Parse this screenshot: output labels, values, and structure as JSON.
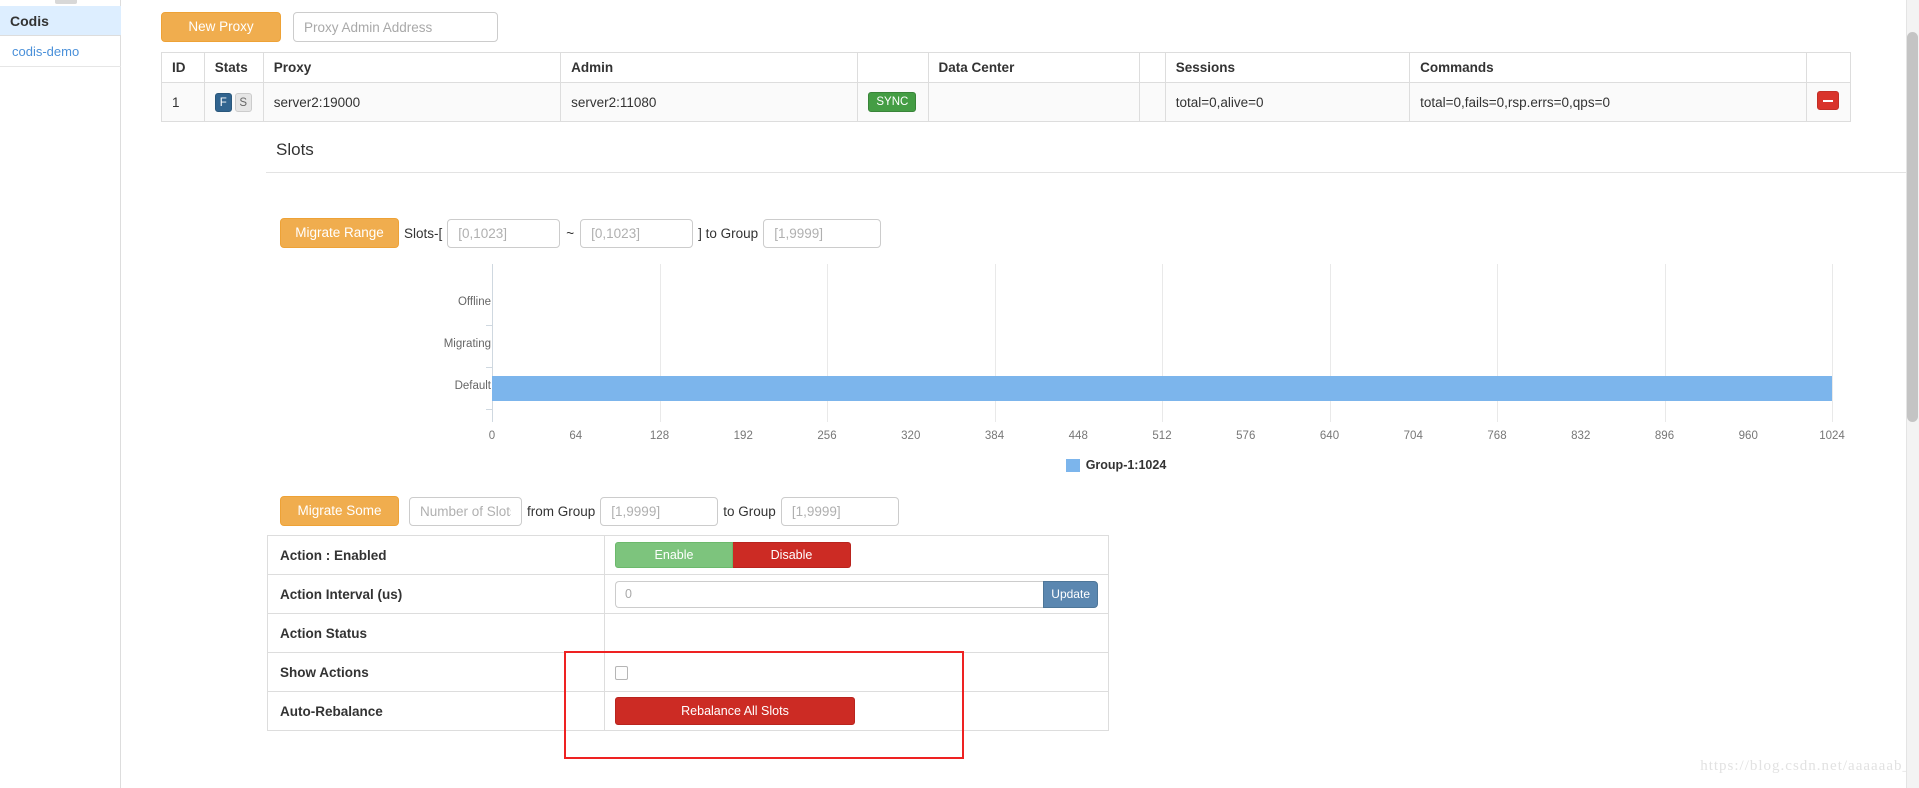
{
  "sidebar": {
    "title": "Codis",
    "items": [
      {
        "label": "codis-demo"
      }
    ]
  },
  "toolbar": {
    "new_proxy_label": "New Proxy",
    "proxy_address_value": "",
    "proxy_address_placeholder": "Proxy Admin Address"
  },
  "proxy_table": {
    "headers": {
      "id": "ID",
      "stats": "Stats",
      "proxy": "Proxy",
      "admin": "Admin",
      "sync": "",
      "data_center": "Data Center",
      "blank": "",
      "sessions": "Sessions",
      "commands": "Commands",
      "actions": ""
    },
    "rows": [
      {
        "id": "1",
        "stats_primary": "F",
        "stats_secondary": "S",
        "proxy": "server2:19000",
        "admin": "server2:11080",
        "sync": "SYNC",
        "data_center": "",
        "sessions": "total=0,alive=0",
        "commands": "total=0,fails=0,rsp.errs=0,qps=0",
        "delete_label": "−"
      }
    ]
  },
  "slots": {
    "title": "Slots",
    "migrate_range": {
      "button_label": "Migrate Range",
      "prefix_label": "Slots-[",
      "from_value": "",
      "from_placeholder": "[0,1023]",
      "separator": "~",
      "to_value": "",
      "to_placeholder": "[0,1023]",
      "suffix_label": "] to Group",
      "group_value": "",
      "group_placeholder": "[1,9999]"
    },
    "migrate_some": {
      "button_label": "Migrate Some",
      "count_value": "",
      "count_placeholder": "Number of Slots",
      "from_label": "from Group",
      "from_value": "",
      "from_placeholder": "[1,9999]",
      "to_label": "to Group",
      "to_value": "",
      "to_placeholder": "[1,9999]"
    }
  },
  "chart_data": {
    "type": "bar",
    "orientation": "horizontal",
    "title": "",
    "xlabel": "",
    "ylabel": "",
    "categories": [
      "Offline",
      "Migrating",
      "Default"
    ],
    "values": [
      0,
      0,
      1024
    ],
    "xlim": [
      0,
      1024
    ],
    "xticks": [
      0,
      64,
      128,
      192,
      256,
      320,
      384,
      448,
      512,
      576,
      640,
      704,
      768,
      832,
      896,
      960,
      1024
    ],
    "grid": true,
    "legend_position": "bottom",
    "series": [
      {
        "name": "Group-1:1024",
        "color": "#7cb5ec",
        "values": [
          0,
          0,
          1024
        ]
      }
    ]
  },
  "settings": {
    "rows": [
      {
        "key": "Action : Enabled"
      },
      {
        "key": "Action Interval (us)"
      },
      {
        "key": "Action Status"
      },
      {
        "key": "Show Actions"
      },
      {
        "key": "Auto-Rebalance"
      }
    ],
    "action_enabled": {
      "enable_label": "Enable",
      "disable_label": "Disable"
    },
    "action_interval": {
      "value": "0",
      "update_label": "Update"
    },
    "action_status": {
      "value": ""
    },
    "show_actions": {
      "checked": false
    },
    "auto_rebalance": {
      "button_label": "Rebalance All Slots"
    }
  },
  "watermark": "https://blog.csdn.net/aaaaaab_"
}
